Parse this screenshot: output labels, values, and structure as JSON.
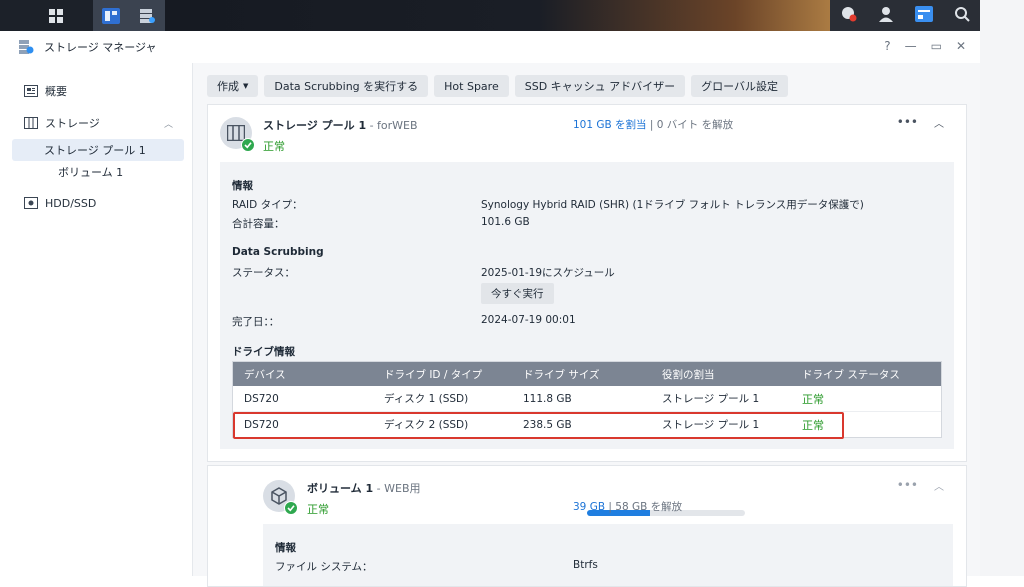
{
  "window": {
    "title": "ストレージ マネージャ",
    "controls": [
      "?",
      "—",
      "▭",
      "✕"
    ]
  },
  "sidebar": {
    "items": [
      {
        "label": "概要",
        "icon": "overview-icon"
      },
      {
        "label": "ストレージ",
        "icon": "storage-icon",
        "expanded": true
      },
      {
        "label": "ストレージ プール 1",
        "selected": true
      },
      {
        "label": "ボリューム 1"
      },
      {
        "label": "HDD/SSD",
        "icon": "hdd-icon"
      }
    ]
  },
  "toolbar": {
    "create": "作成",
    "scrub": "Data Scrubbing を実行する",
    "hotspare": "Hot Spare",
    "ssdcache": "SSD キャッシュ アドバイザー",
    "global": "グローバル設定"
  },
  "pool": {
    "name": "ストレージ プール 1",
    "subtitle": " - forWEB",
    "status": "正常",
    "allocated": "101 GB を割当",
    "free": " | 0 バイト を解放",
    "info_heading": "情報",
    "raid_label": "RAID タイプ：",
    "raid_value": "Synology Hybrid RAID (SHR) (1ドライブ フォルト トレランス用データ保護で)",
    "capacity_label": "合計容量：",
    "capacity_value": "101.6 GB",
    "scrub_heading": "Data Scrubbing",
    "scrub_status_label": "ステータス：",
    "scrub_status_value": "2025-01-19にスケジュール",
    "run_now": "今すぐ実行",
    "completed_label": "完了日：：",
    "completed_value": "2024-07-19 00:01",
    "drive_heading": "ドライブ情報",
    "columns": [
      "デバイス",
      "ドライブ ID / タイプ",
      "ドライブ サイズ",
      "役割の割当",
      "ドライブ ステータス"
    ],
    "drives": [
      {
        "device": "DS720",
        "id": "ディスク 1 (SSD)",
        "size": "111.8 GB",
        "role": "ストレージ プール 1",
        "status": "正常"
      },
      {
        "device": "DS720",
        "id": "ディスク 2 (SSD)",
        "size": "238.5 GB",
        "role": "ストレージ プール 1",
        "status": "正常"
      }
    ]
  },
  "volume": {
    "name": "ボリューム 1",
    "subtitle": " - WEB用",
    "status": "正常",
    "used": "39 GB",
    "free": " | 58 GB を解放",
    "usage_fraction": 0.4,
    "info_heading": "情報",
    "fs_label": "ファイル システム：",
    "fs_value": "Btrfs"
  },
  "colors": {
    "accent": "#1d74d6",
    "ok": "#2a9a2a",
    "highlight": "#d9382e",
    "table_header": "#7c8593"
  }
}
